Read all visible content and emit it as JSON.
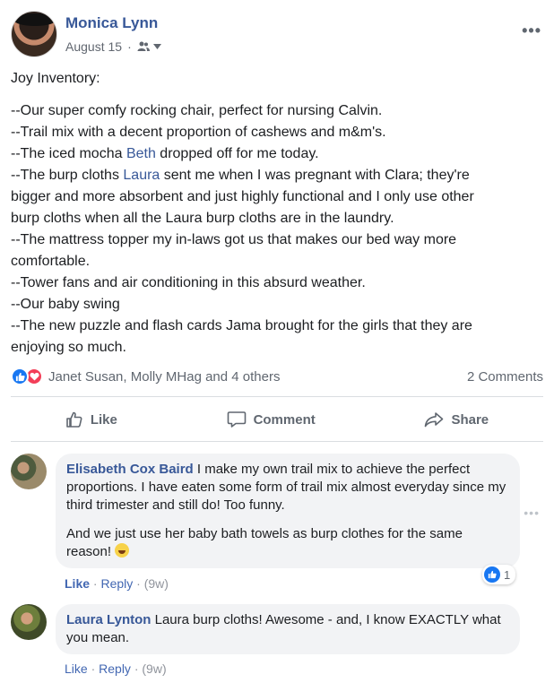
{
  "post": {
    "author": "Monica Lynn",
    "date": "August 15",
    "separator": "·",
    "audience_icon": "friends-icon",
    "body_lines": [
      "Joy Inventory:",
      "--Our super comfy rocking chair, perfect for nursing Calvin.",
      "--Trail mix with a decent proportion of cashews and m&m's.",
      "--The iced mocha ",
      "Beth",
      " dropped off for me today.",
      "--The burp cloths ",
      "Laura",
      " sent me when I was pregnant with Clara; they're",
      "bigger and more absorbent and just highly functional and I only use other",
      "burp cloths when all the Laura burp cloths are in the laundry.",
      "--The mattress topper my in-laws got us that makes our bed way more",
      "comfortable.",
      "--Tower fans and air conditioning in this absurd weather.",
      "--Our baby swing",
      "--The new puzzle and flash cards Jama brought for the girls that they are",
      "enjoying so much."
    ],
    "more_label": "•••"
  },
  "reactions": {
    "names": "Janet Susan, Molly MHag and 4 others",
    "comments_count": "2 Comments",
    "icons": [
      "like-reaction-icon",
      "love-reaction-icon"
    ]
  },
  "actions": {
    "like": "Like",
    "comment": "Comment",
    "share": "Share"
  },
  "comments": [
    {
      "author": "Elisabeth Cox Baird",
      "text_1": " I make my own trail mix to achieve the perfect proportions. I have eaten some form of trail mix almost everyday since my third trimester and still do! Too funny.",
      "text_2": "And we just use her baby bath towels as burp clothes for the same reason! ",
      "like_label": "Like",
      "dot": "·",
      "reply_label": "Reply",
      "time": "(9w)",
      "reaction_count": "1"
    },
    {
      "author": "Laura Lynton",
      "text_1": " Laura burp cloths! Awesome - and, I know EXACTLY what you mean.",
      "like_label": "Like",
      "dot": "·",
      "reply_label": "Reply",
      "time": "(9w)"
    }
  ],
  "colors": {
    "link": "#385898",
    "like_blue": "#1877f2",
    "love_red": "#f33e58",
    "bubble_bg": "#f2f3f5",
    "muted_text": "#606770"
  }
}
